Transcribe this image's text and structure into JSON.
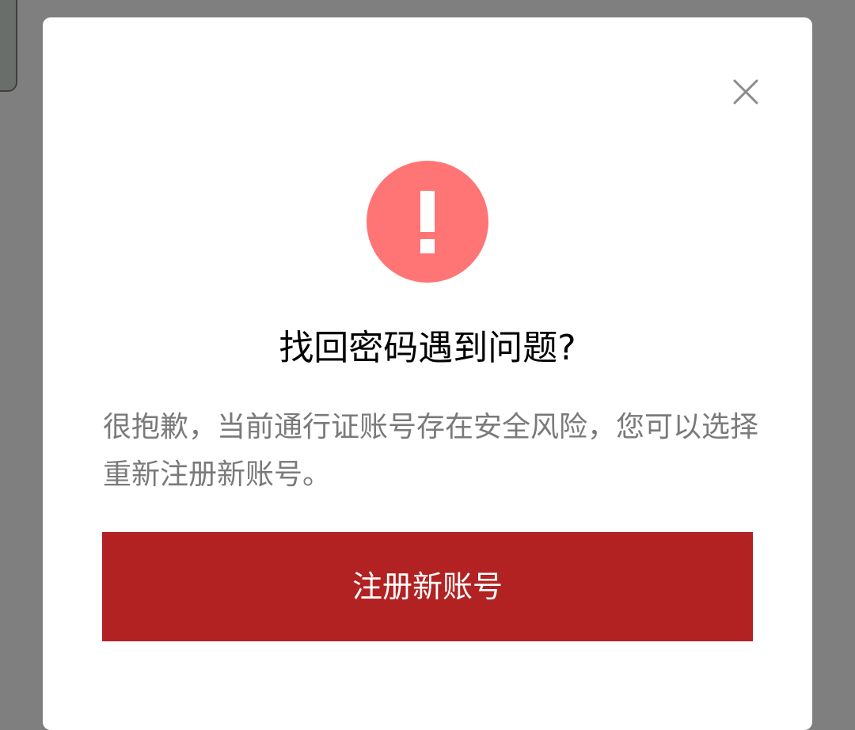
{
  "dialog": {
    "title": "找回密码遇到问题?",
    "message": "很抱歉，当前通行证账号存在安全风险，您可以选择重新注册新账号。",
    "primary_button_label": "注册新账号",
    "icons": {
      "close": "close-icon",
      "alert": "exclamation-icon"
    },
    "colors": {
      "alert": "#ff7575",
      "primary": "#b22222",
      "overlay": "#7f7f7f"
    }
  }
}
